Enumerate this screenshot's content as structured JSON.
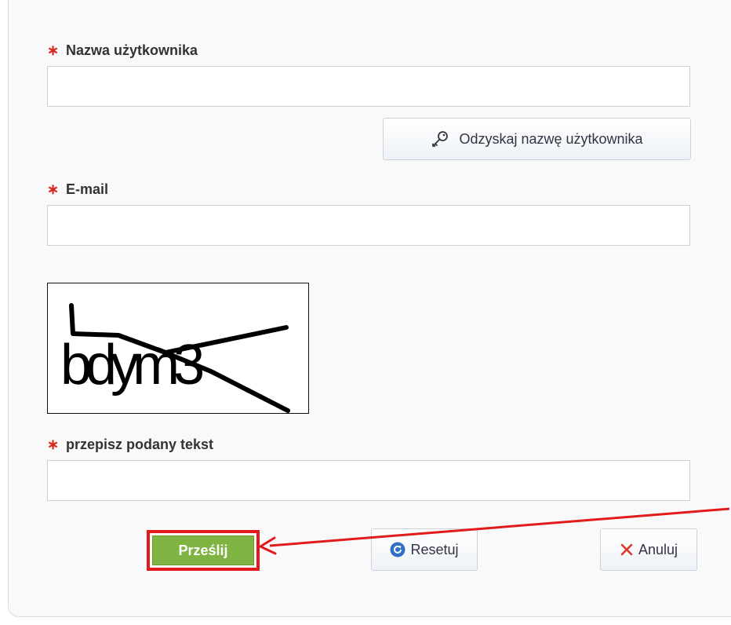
{
  "form": {
    "username_label": "Nazwa użytkownika",
    "username_value": "",
    "recover_label": "Odzyskaj nazwę użytkownika",
    "email_label": "E-mail",
    "email_value": "",
    "captcha_text": "bdym3",
    "captcha_label": "przepisz podany tekst",
    "captcha_value": "",
    "required_mark": "∗"
  },
  "buttons": {
    "submit_label": "Prześlij",
    "reset_label": "Resetuj",
    "cancel_label": "Anuluj"
  },
  "icons": {
    "recover": "key-icon",
    "reset": "refresh-icon",
    "cancel": "close-icon"
  },
  "colors": {
    "required": "#d9281f",
    "submit": "#7fb342",
    "highlight": "#e11b1b",
    "reset_icon": "#2f6fc4",
    "cancel_icon": "#e0352b"
  }
}
